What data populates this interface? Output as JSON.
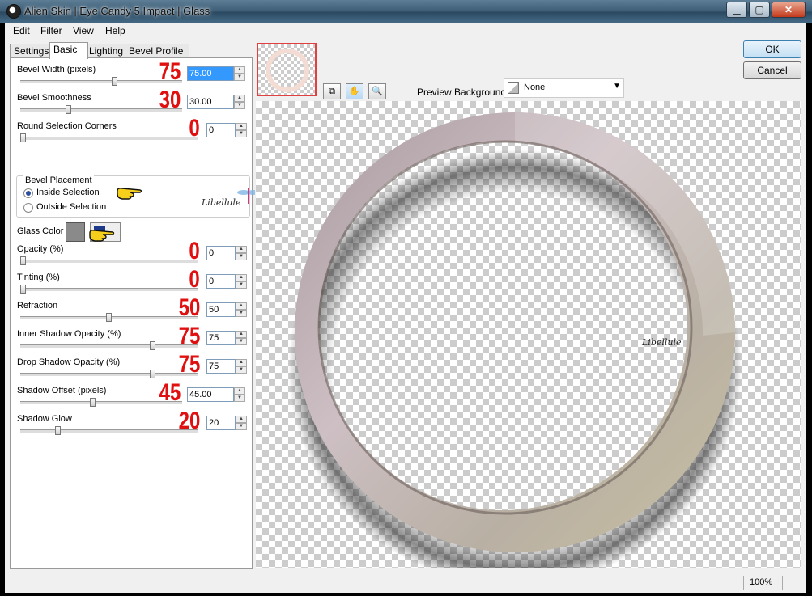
{
  "window": {
    "title": "Alien Skin | Eye Candy 5 Impact | Glass"
  },
  "menu": [
    "Edit",
    "Filter",
    "View",
    "Help"
  ],
  "tabs": [
    "Settings",
    "Basic",
    "Lighting",
    "Bevel Profile"
  ],
  "active_tab": "Basic",
  "controls": {
    "bevel_width": {
      "label": "Bevel Width (pixels)",
      "value": "75.00",
      "annotation": "75"
    },
    "bevel_smoothness": {
      "label": "Bevel Smoothness",
      "value": "30.00",
      "annotation": "30"
    },
    "round_corners": {
      "label": "Round Selection Corners",
      "value": "0",
      "annotation": "0"
    },
    "bevel_placement": {
      "label": "Bevel Placement",
      "inside": "Inside Selection",
      "outside": "Outside Selection",
      "selected": "inside"
    },
    "glass_color": {
      "label": "Glass Color",
      "color": "#8a8a8a"
    },
    "opacity": {
      "label": "Opacity (%)",
      "value": "0",
      "annotation": "0"
    },
    "tinting": {
      "label": "Tinting (%)",
      "value": "0",
      "annotation": "0"
    },
    "refraction": {
      "label": "Refraction",
      "value": "50",
      "annotation": "50"
    },
    "inner_shadow_opacity": {
      "label": "Inner Shadow Opacity (%)",
      "value": "75",
      "annotation": "75"
    },
    "drop_shadow_opacity": {
      "label": "Drop Shadow Opacity (%)",
      "value": "75",
      "annotation": "75"
    },
    "shadow_offset": {
      "label": "Shadow Offset (pixels)",
      "value": "45.00",
      "annotation": "45"
    },
    "shadow_glow": {
      "label": "Shadow Glow",
      "value": "20",
      "annotation": "20"
    }
  },
  "preview": {
    "background_label": "Preview Background:",
    "background_value": "None"
  },
  "buttons": {
    "ok": "OK",
    "cancel": "Cancel"
  },
  "status": {
    "zoom": "100%"
  },
  "watermark": "Libellule",
  "colors": {
    "annotation": "#e01010",
    "title_bar": "#3f6078"
  }
}
